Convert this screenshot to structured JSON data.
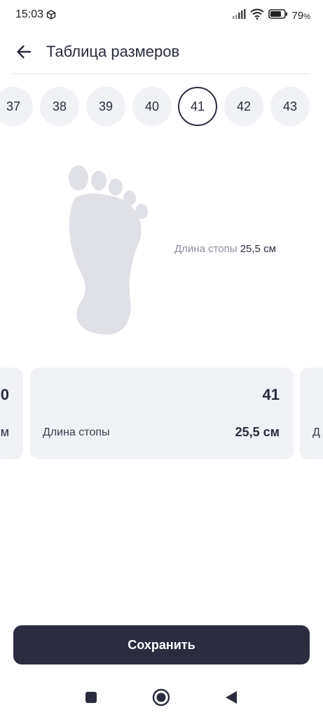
{
  "status_bar": {
    "time": "15:03",
    "left_icon": "package-icon",
    "signal_icon": "signal-icon",
    "wifi_icon": "wifi-icon",
    "battery_icon": "battery-icon",
    "battery_level": 0.79,
    "battery_text": "79",
    "battery_unit": "%"
  },
  "header": {
    "back_icon": "arrow-left-icon",
    "title": "Таблица размеров"
  },
  "sizes": {
    "items": [
      "37",
      "38",
      "39",
      "40",
      "41",
      "42",
      "43"
    ],
    "selected": "41"
  },
  "foot": {
    "icon": "footprint-icon",
    "label": "Длина стопы",
    "value": "25,5 см"
  },
  "cards": {
    "prev": {
      "size": "0",
      "value": "м"
    },
    "main": {
      "size": "41",
      "label": "Длина стопы",
      "value": "25,5 см"
    },
    "next": {
      "label": "Д"
    }
  },
  "save_button": {
    "label": "Сохранить"
  },
  "nav": {
    "recent_icon": "square-icon",
    "home_icon": "circle-home-icon",
    "back_icon": "triangle-back-icon"
  },
  "colors": {
    "accent_dark": "#2b2d3f",
    "chip_bg": "#f1f2f6",
    "card_bg": "#f1f2f6",
    "muted_text": "#8b8d9c",
    "foot_fill": "#e0e1e7"
  }
}
